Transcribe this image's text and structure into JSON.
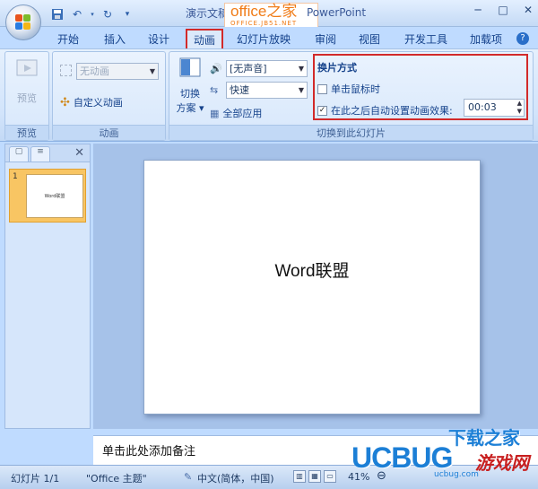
{
  "title_bar": {
    "doc_title": "演示文稿",
    "app_name": "PowerPoint",
    "watermark_logo": "office之家",
    "watermark_url": "OFFICE.JB51.NET",
    "qat": [
      "save-icon",
      "undo-icon",
      "redo-icon",
      "customize-icon"
    ],
    "window_controls": [
      "minimize-icon",
      "maximize-icon",
      "close-icon"
    ]
  },
  "tabs": [
    {
      "label": "开始"
    },
    {
      "label": "插入"
    },
    {
      "label": "设计"
    },
    {
      "label": "动画",
      "active": true
    },
    {
      "label": "幻灯片放映"
    },
    {
      "label": "审阅"
    },
    {
      "label": "视图"
    },
    {
      "label": "开发工具"
    },
    {
      "label": "加载项"
    }
  ],
  "ribbon": {
    "preview_group": {
      "button": "预览",
      "label": "预览"
    },
    "animation_group": {
      "combo_value": "无动画",
      "custom_anim": "自定义动画",
      "label": "动画"
    },
    "transition_group": {
      "scheme_line1": "切换",
      "scheme_line2": "方案",
      "sound_value": "[无声音]",
      "speed_value": "快速",
      "apply_all": "全部应用",
      "advance_title": "换片方式",
      "on_click": "单击鼠标时",
      "on_click_checked": false,
      "auto_after": "在此之后自动设置动画效果:",
      "auto_after_checked": true,
      "time_value": "00:03",
      "label": "切换到此幻灯片"
    }
  },
  "left_pane": {
    "slide_number": "1",
    "thumb_text": "Word联盟"
  },
  "slide": {
    "text": "Word联盟"
  },
  "notes": {
    "placeholder": "单击此处添加备注"
  },
  "status_bar": {
    "slide_info": "幻灯片 1/1",
    "theme": "\"Office 主题\"",
    "language": "中文(简体，中国)",
    "zoom": "41%"
  },
  "watermark": {
    "brand": "UCBUG",
    "slogan": "下载之家",
    "game": "游戏网",
    "url": "ucbug.com"
  },
  "accent_colors": {
    "highlight_red": "#d22a2a",
    "ribbon_blue": "#bfdbff"
  }
}
